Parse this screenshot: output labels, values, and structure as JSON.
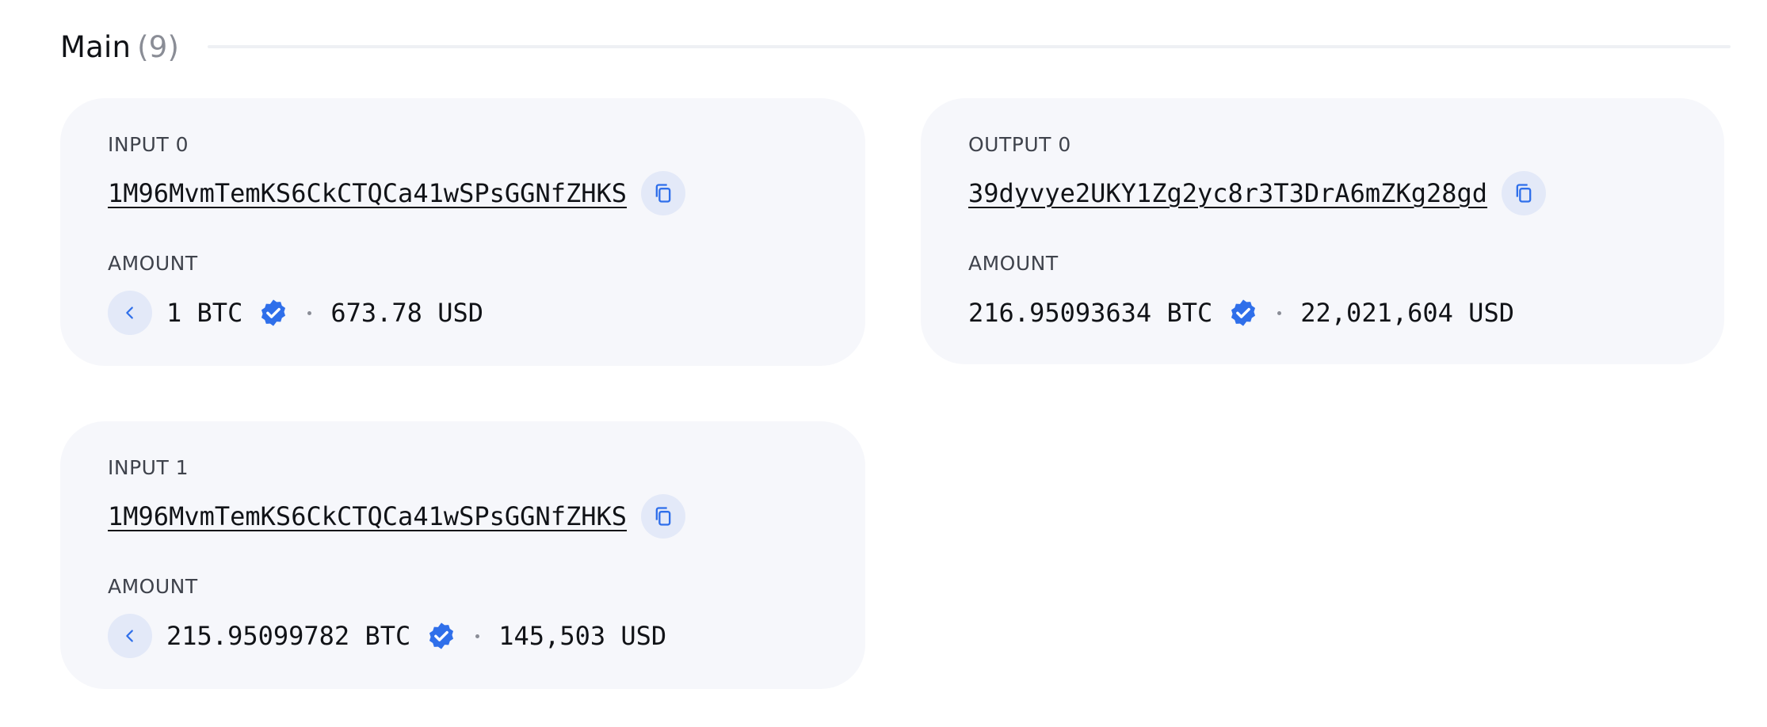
{
  "section": {
    "title": "Main",
    "count": "(9)"
  },
  "cards": {
    "input0": {
      "label": "INPUT 0",
      "address": "1M96MvmTemKS6CkCTQCa41wSPsGGNfZHKS",
      "amount_label": "AMOUNT",
      "btc": "1 BTC",
      "usd": "673.78 USD"
    },
    "output0": {
      "label": "OUTPUT 0",
      "address": "39dyvye2UKY1Zg2yc8r3T3DrA6mZKg28gd",
      "amount_label": "AMOUNT",
      "btc": "216.95093634 BTC",
      "usd": "22,021,604 USD"
    },
    "input1": {
      "label": "INPUT 1",
      "address": "1M96MvmTemKS6CkCTQCa41wSPsGGNfZHKS",
      "amount_label": "AMOUNT",
      "btc": "215.95099782 BTC",
      "usd": "145,503 USD"
    }
  },
  "icons": {
    "copy": "copy-icon",
    "back": "chevron-left-icon",
    "verified": "verified-badge-icon"
  },
  "colors": {
    "accent": "#2f6fea",
    "card_bg": "#f6f7fb",
    "button_bg": "#e3e9f8",
    "muted": "#8a8d96"
  }
}
